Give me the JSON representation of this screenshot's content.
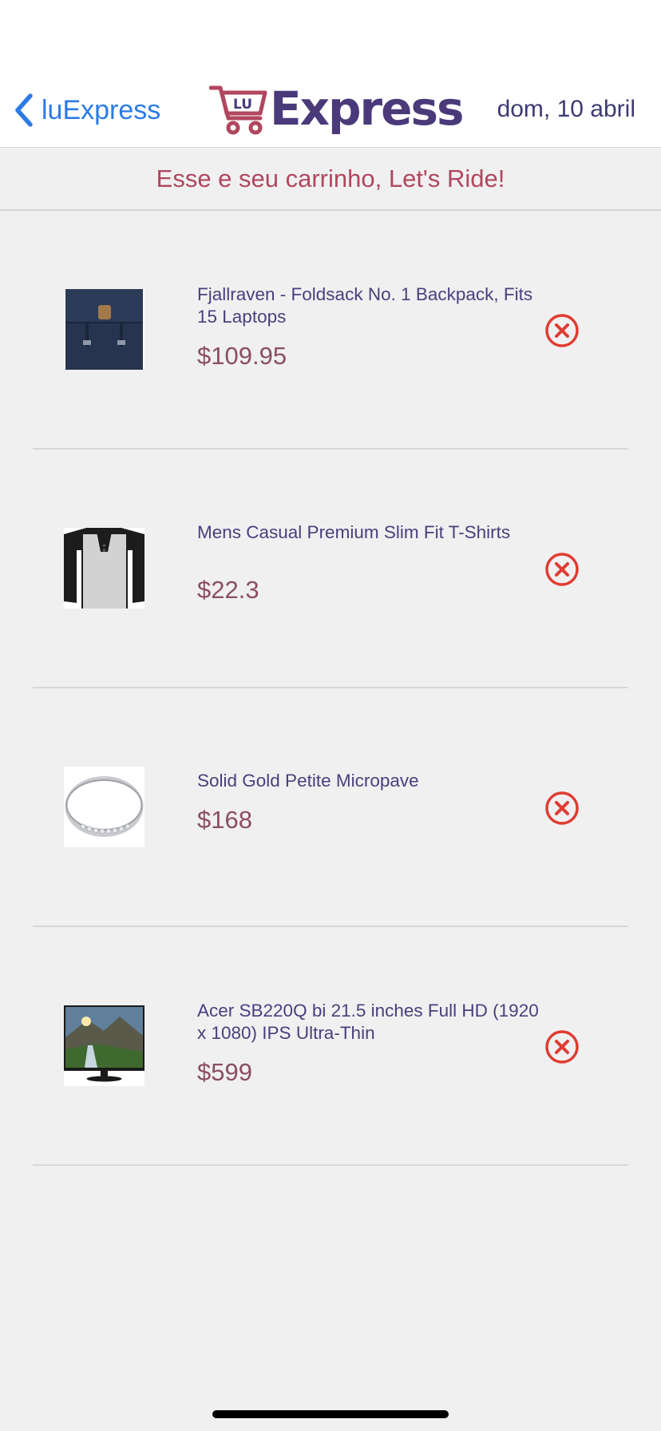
{
  "nav": {
    "back_label": "luExpress",
    "logo_badge": "LU",
    "logo_text": "Express",
    "date": "dom, 10 abril"
  },
  "banner": {
    "text": "Esse e seu carrinho, Let's Ride!"
  },
  "cart": {
    "items": [
      {
        "name": "Fjallraven - Foldsack No. 1 Backpack, Fits 15 Laptops",
        "price": "$109.95",
        "thumb": "backpack-image"
      },
      {
        "name": "Mens Casual Premium Slim Fit T-Shirts",
        "price": "$22.3",
        "thumb": "tshirt-image"
      },
      {
        "name": "Solid Gold Petite Micropave",
        "price": "$168",
        "thumb": "ring-image"
      },
      {
        "name": "Acer SB220Q bi 21.5 inches Full HD (1920 x 1080) IPS Ultra-Thin",
        "price": "$599",
        "thumb": "monitor-image"
      }
    ],
    "remove_icon": "remove-circle-icon"
  },
  "colors": {
    "accent_blue": "#2c7be5",
    "brand_purple": "#4a3a7a",
    "brand_red": "#b0475e",
    "price": "#8b4e62",
    "remove_red": "#e03c31"
  }
}
